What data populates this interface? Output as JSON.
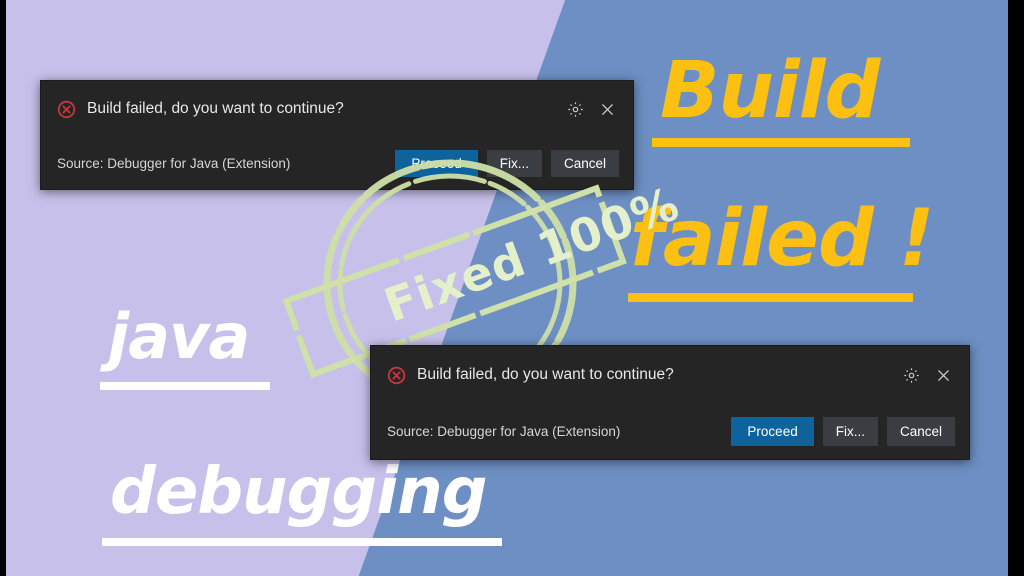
{
  "background": {
    "left_color": "#C6C0EA",
    "right_color": "#6D8FC4",
    "frame_color": "#000000"
  },
  "overlay_text": {
    "title_line1": "Build",
    "title_line2": "failed !",
    "subtitle_line1": "java",
    "subtitle_line2": "debugging",
    "title_color": "#FBC012",
    "subtitle_color": "#FFFFFF"
  },
  "stamp": {
    "label": "Fixed 100%",
    "color": "#E4F0C9"
  },
  "dialogs": [
    {
      "id": "dialog-1",
      "icon": "error-circle-x-icon",
      "message": "Build failed, do you want to continue?",
      "source": "Source: Debugger for Java (Extension)",
      "gear_icon": "gear-icon",
      "close_icon": "close-icon",
      "buttons": [
        {
          "label": "Proceed",
          "style": "primary",
          "color": "#0E639C"
        },
        {
          "label": "Fix...",
          "style": "secondary",
          "color": "#3A3D41"
        },
        {
          "label": "Cancel",
          "style": "secondary",
          "color": "#3A3D41"
        }
      ]
    },
    {
      "id": "dialog-2",
      "icon": "error-circle-x-icon",
      "message": "Build failed, do you want to continue?",
      "source": "Source: Debugger for Java (Extension)",
      "gear_icon": "gear-icon",
      "close_icon": "close-icon",
      "buttons": [
        {
          "label": "Proceed",
          "style": "primary",
          "color": "#0E639C"
        },
        {
          "label": "Fix...",
          "style": "secondary",
          "color": "#3A3D41"
        },
        {
          "label": "Cancel",
          "style": "secondary",
          "color": "#3A3D41"
        }
      ]
    }
  ]
}
